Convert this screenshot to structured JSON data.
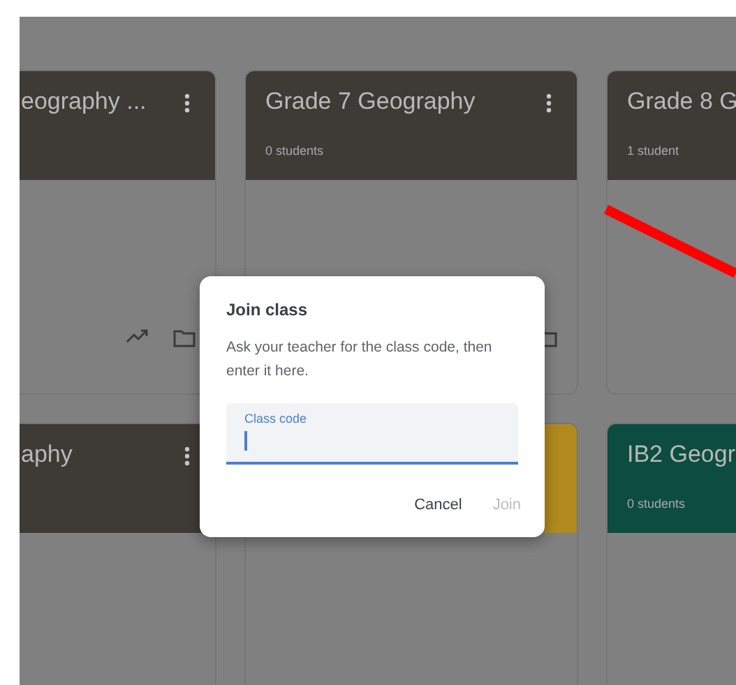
{
  "classes": [
    {
      "title": "eography ...",
      "color": "#3c3b36",
      "actions": true
    },
    {
      "title": "Grade 7 Geography",
      "students": "0 students",
      "color": "#3c3b36",
      "actions": true
    },
    {
      "title": "Grade 8 G",
      "students": "1 student",
      "color": "#3c3b36"
    },
    {
      "title": "aphy",
      "color": "#3c3b36"
    },
    {
      "color": "#b08a1e"
    },
    {
      "title": "IB2 Geogr",
      "students": "0 students",
      "color": "#0c4d40"
    }
  ],
  "dialog": {
    "title": "Join class",
    "text": "Ask your teacher for the class code, then enter it here.",
    "field": {
      "label": "Class code",
      "focused": true
    },
    "buttons": [
      {
        "label": "Cancel",
        "disabled": false
      },
      {
        "label": "Join",
        "disabled": true
      }
    ]
  }
}
